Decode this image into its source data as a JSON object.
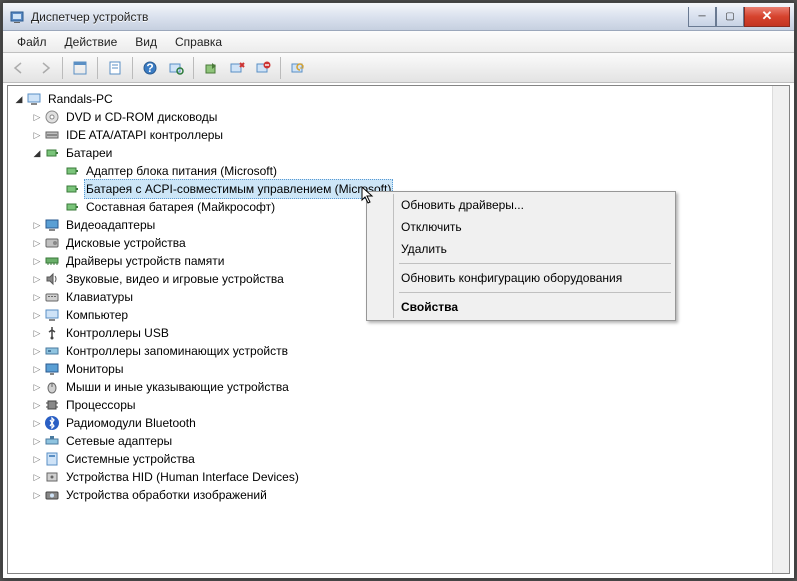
{
  "window": {
    "title": "Диспетчер устройств"
  },
  "menu": {
    "file": "Файл",
    "action": "Действие",
    "view": "Вид",
    "help": "Справка"
  },
  "tree": {
    "root": "Randals-PC",
    "dvd": "DVD и CD-ROM дисководы",
    "ide": "IDE ATA/ATAPI контроллеры",
    "batteries": "Батареи",
    "bat_adapter": "Адаптер блока питания (Microsoft)",
    "bat_acpi": "Батарея с ACPI-совместимым управлением (Microsoft)",
    "bat_composite": "Составная батарея (Майкрософт)",
    "video": "Видеоадаптеры",
    "disk": "Дисковые устройства",
    "memory": "Драйверы устройств памяти",
    "sound": "Звуковые, видео и игровые устройства",
    "keyboard": "Клавиатуры",
    "computer": "Компьютер",
    "usb": "Контроллеры USB",
    "storage": "Контроллеры запоминающих устройств",
    "monitor": "Мониторы",
    "mouse": "Мыши и иные указывающие устройства",
    "processor": "Процессоры",
    "bluetooth": "Радиомодули Bluetooth",
    "network": "Сетевые адаптеры",
    "system": "Системные устройства",
    "hid": "Устройства HID (Human Interface Devices)",
    "imaging": "Устройства обработки изображений"
  },
  "context": {
    "update": "Обновить драйверы...",
    "disable": "Отключить",
    "uninstall": "Удалить",
    "scan": "Обновить конфигурацию оборудования",
    "properties": "Свойства"
  }
}
